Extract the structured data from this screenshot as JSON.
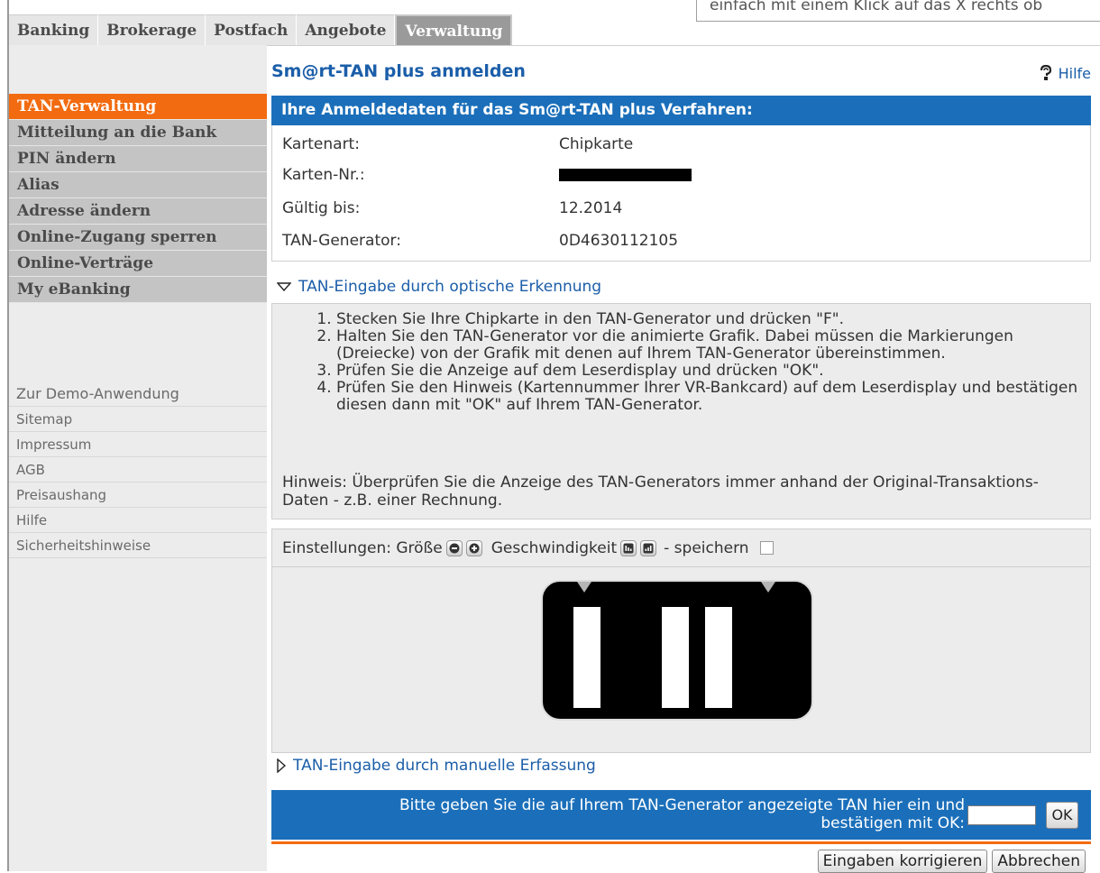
{
  "banner_text": "einfach mit einem Klick auf das X rechts ob",
  "tabs": [
    {
      "label": "Banking",
      "active": false
    },
    {
      "label": "Brokerage",
      "active": false
    },
    {
      "label": "Postfach",
      "active": false
    },
    {
      "label": "Angebote",
      "active": false
    },
    {
      "label": "Verwaltung",
      "active": true
    }
  ],
  "sidebar": {
    "items": [
      {
        "label": "TAN-Verwaltung",
        "active": true
      },
      {
        "label": "Mitteilung an die Bank",
        "active": false
      },
      {
        "label": "PIN ändern",
        "active": false
      },
      {
        "label": "Alias",
        "active": false
      },
      {
        "label": "Adresse ändern",
        "active": false
      },
      {
        "label": "Online-Zugang sperren",
        "active": false
      },
      {
        "label": "Online-Verträge",
        "active": false
      },
      {
        "label": "My eBanking",
        "active": false
      }
    ],
    "links": [
      "Zur Demo-Anwendung",
      "Sitemap",
      "Impressum",
      "AGB",
      "Preisaushang",
      "Hilfe",
      "Sicherheitshinweise"
    ]
  },
  "main": {
    "title": "Sm@rt-TAN plus anmelden",
    "help_label": "Hilfe",
    "section_header": "Ihre Anmeldedaten für das Sm@rt-TAN plus Verfahren:",
    "fields": [
      {
        "label": "Kartenart:",
        "value": "Chipkarte"
      },
      {
        "label": "Karten-Nr.:",
        "value": ""
      },
      {
        "label": "Gültig bis:",
        "value": "12.2014"
      },
      {
        "label": "TAN-Generator:",
        "value": "0D4630112105"
      }
    ],
    "optical_toggle": "TAN-Eingabe durch optische Erkennung",
    "steps": [
      "Stecken Sie Ihre Chipkarte in den TAN-Generator und drücken \"F\".",
      "Halten Sie den TAN-Generator vor die animierte Grafik. Dabei müssen die Markierungen (Dreiecke) von der Grafik mit denen auf Ihrem TAN-Generator übereinstimmen.",
      "Prüfen Sie die Anzeige auf dem Leserdisplay und drücken \"OK\".",
      "Prüfen Sie den Hinweis (Kartennummer Ihrer VR-Bankcard) auf dem Leserdisplay und bestätigen diesen dann mit \"OK\" auf Ihrem TAN-Generator."
    ],
    "hint": "Hinweis: Überprüfen Sie die Anzeige des TAN-Generators immer anhand der Original-Transaktions-Daten - z.B. einer Rechnung.",
    "settings": {
      "label": "Einstellungen: Größe",
      "speed_label": "Geschwindigkeit",
      "save_label": "- speichern",
      "save_checked": false
    },
    "manual_toggle": "TAN-Eingabe durch manuelle Erfassung",
    "tan_prompt_line1": "Bitte geben Sie die auf Ihrem TAN-Generator angezeigte TAN hier ein und",
    "tan_prompt_line2": "bestätigen mit OK:",
    "tan_value": "",
    "ok_label": "OK",
    "correct_label": "Eingaben korrigieren",
    "cancel_label": "Abbrechen"
  },
  "colors": {
    "accent_orange": "#f26b10",
    "header_blue": "#1b6fba",
    "link_blue": "#1b5ea9"
  }
}
